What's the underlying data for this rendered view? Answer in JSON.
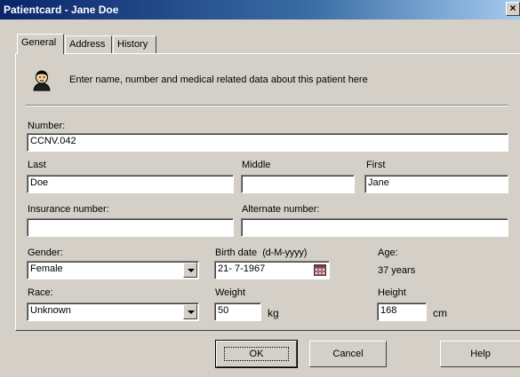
{
  "window": {
    "title": "Patientcard - Jane Doe",
    "close_glyph": "×"
  },
  "tabs": [
    {
      "label": "General",
      "active": true
    },
    {
      "label": "Address",
      "active": false
    },
    {
      "label": "History",
      "active": false
    }
  ],
  "header": {
    "icon": "patient-card-icon",
    "instruction": "Enter name, number and medical related data about this patient here"
  },
  "fields": {
    "number": {
      "label": "Number:",
      "value": "CCNV.042"
    },
    "last": {
      "label": "Last",
      "value": "Doe"
    },
    "middle": {
      "label": "Middle",
      "value": ""
    },
    "first": {
      "label": "First",
      "value": "Jane"
    },
    "insurance": {
      "label": "Insurance number:",
      "value": ""
    },
    "alternate": {
      "label": "Alternate number:",
      "value": ""
    },
    "gender": {
      "label": "Gender:",
      "value": "Female"
    },
    "birth_date": {
      "label": "Birth date",
      "format": "(d-M-yyyy)",
      "value": "21- 7-1967"
    },
    "age": {
      "label": "Age:",
      "value": "37 years"
    },
    "race": {
      "label": "Race:",
      "value": "Unknown"
    },
    "weight": {
      "label": "Weight",
      "value": "50",
      "unit": "kg"
    },
    "height": {
      "label": "Height",
      "value": "168",
      "unit": "cm"
    }
  },
  "buttons": {
    "ok": "OK",
    "cancel": "Cancel",
    "help": "Help"
  },
  "colors": {
    "titlebar_start": "#0a246a",
    "titlebar_end": "#a6caf0",
    "face": "#d4d0c8"
  }
}
